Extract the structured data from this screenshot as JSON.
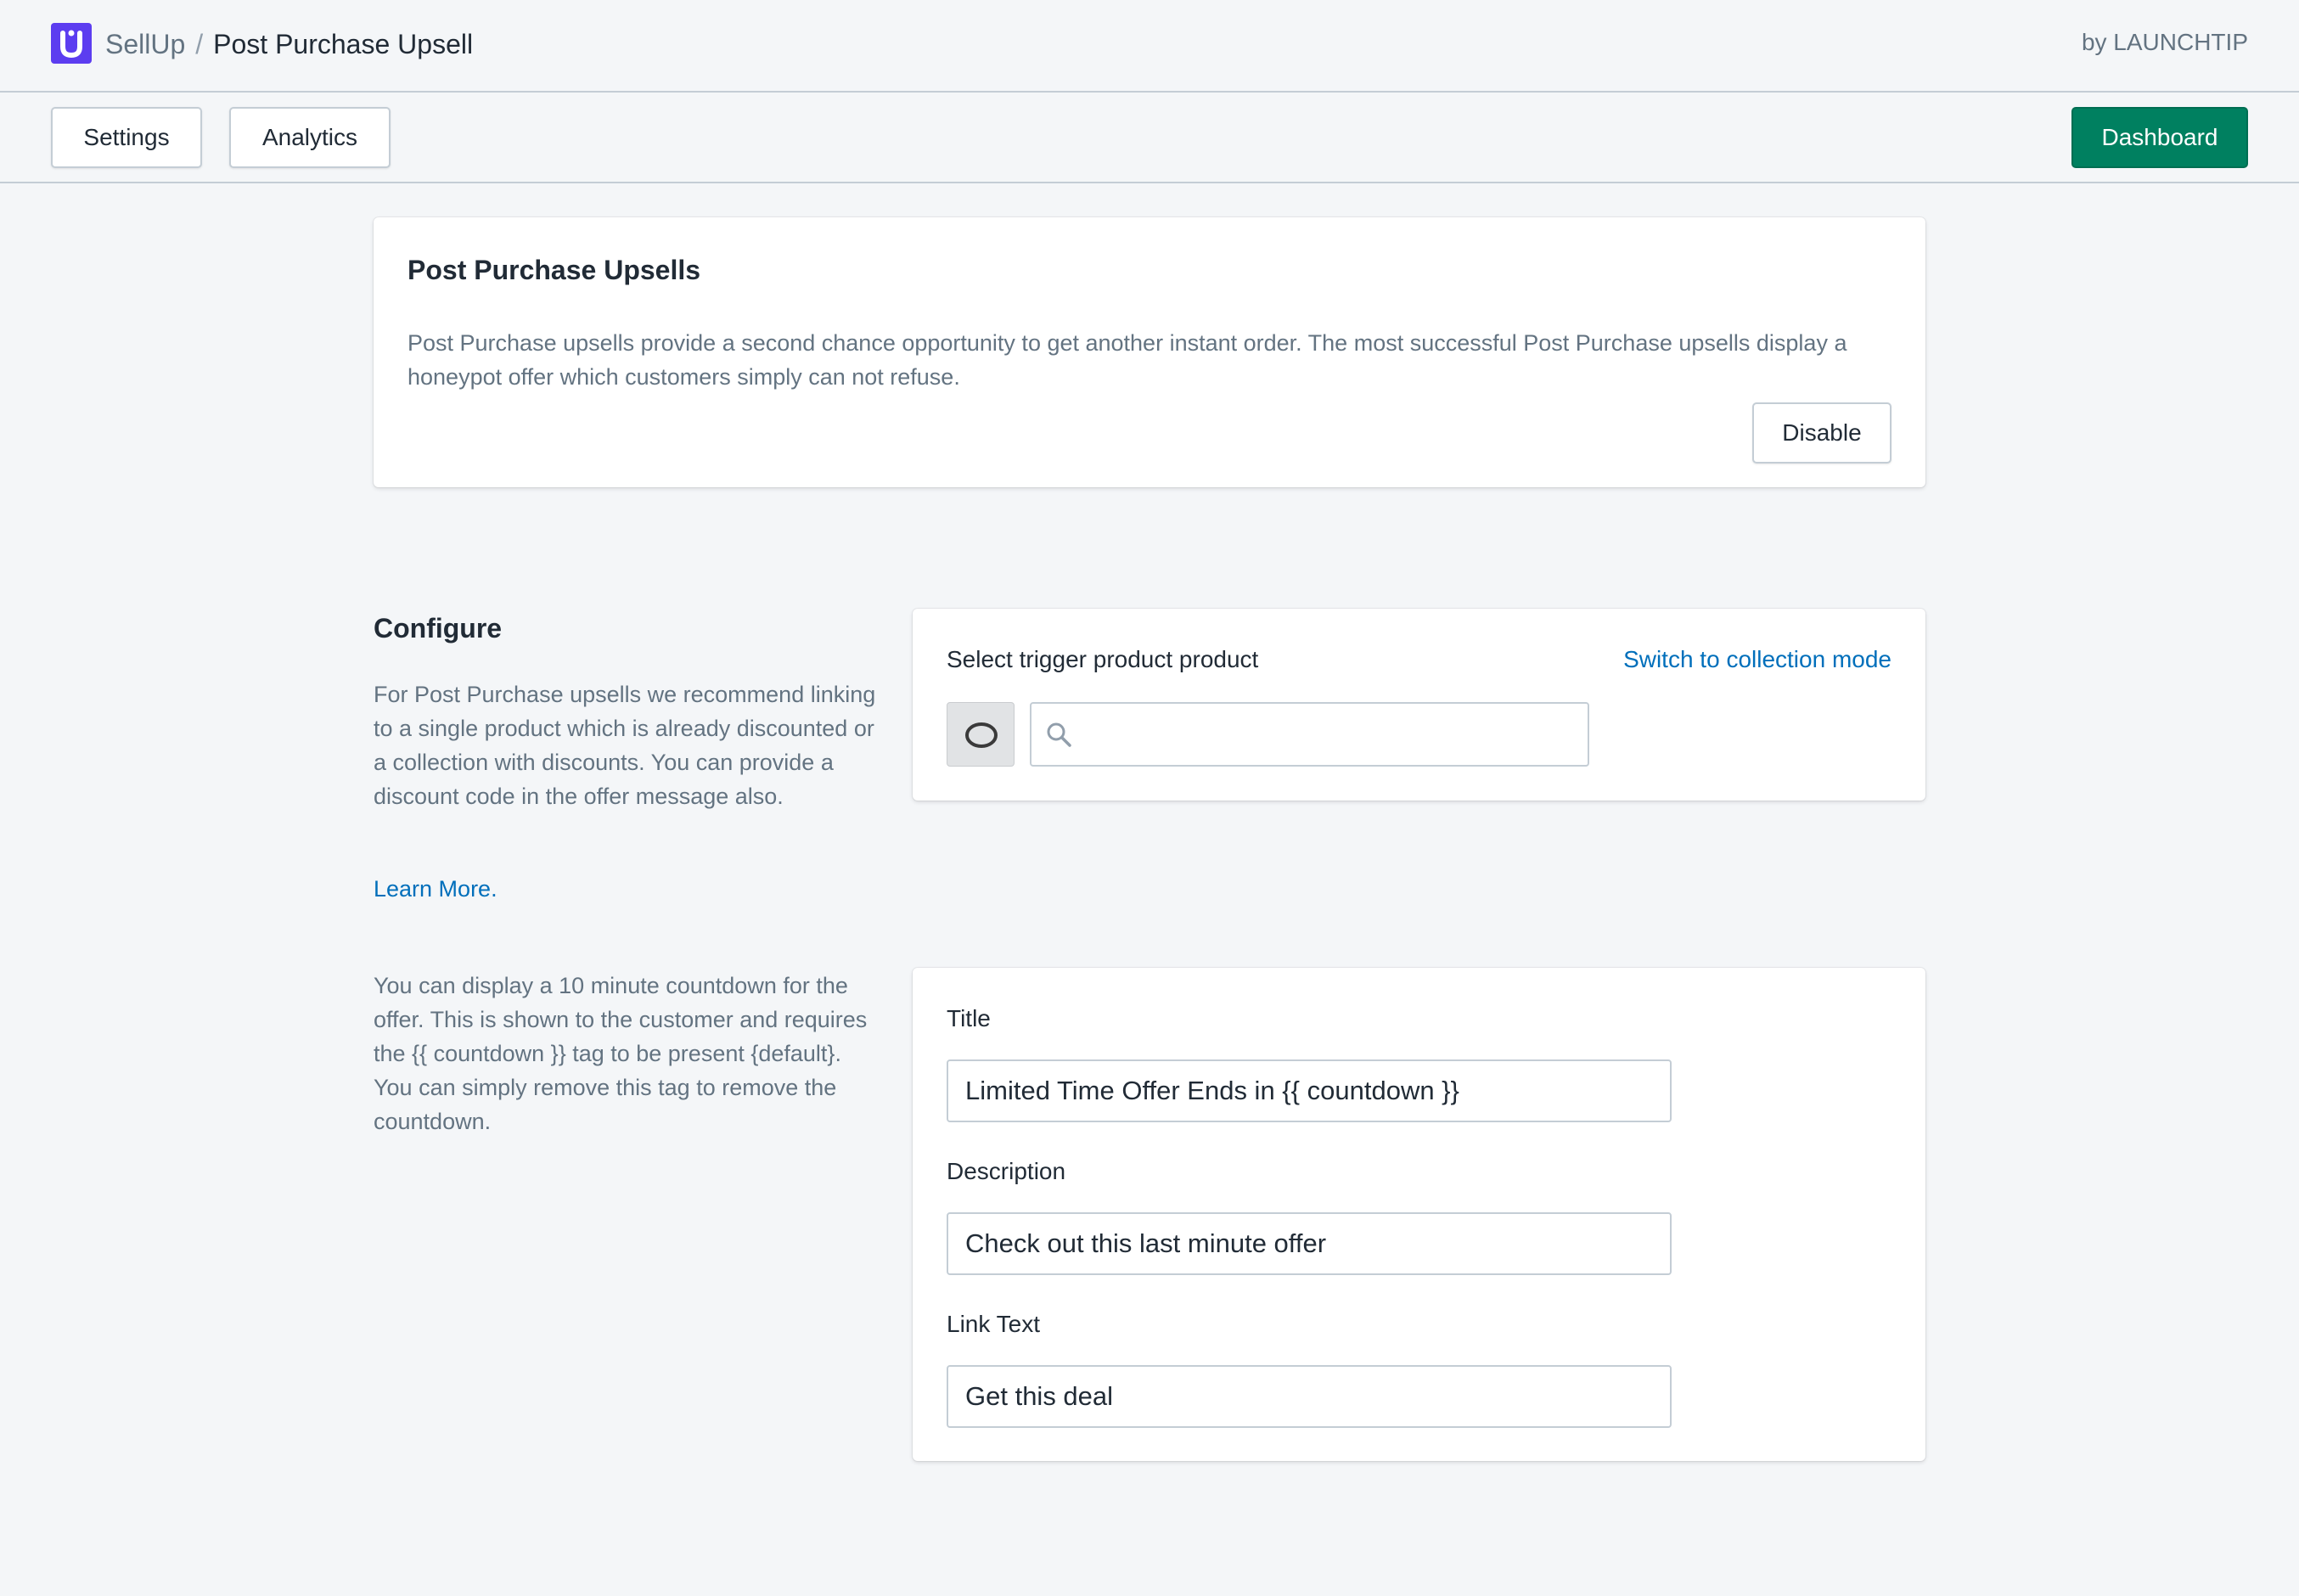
{
  "header": {
    "app_name": "SellUp",
    "separator": "/",
    "page_name": "Post Purchase Upsell",
    "byline": "by LAUNCHTIP"
  },
  "toolbar": {
    "settings_label": "Settings",
    "analytics_label": "Analytics",
    "dashboard_label": "Dashboard"
  },
  "intro_card": {
    "title": "Post Purchase Upsells",
    "description": "Post Purchase upsells provide a second chance opportunity to get another instant order. The most successful Post Purchase upsells display a honeypot offer which customers simply can not refuse.",
    "disable_label": "Disable"
  },
  "configure": {
    "heading": "Configure",
    "description": "For Post Purchase upsells we recommend linking to a single product which is already discounted or a collection with discounts. You can provide a discount code in the offer message also.",
    "learn_more": "Learn More.",
    "countdown_description": "You can display a 10 minute countdown for the offer. This is shown to the customer and requires the {{ countdown }} tag to be present {default}. You can simply remove this tag to remove the countdown."
  },
  "trigger_card": {
    "label": "Select trigger product product",
    "switch_link": "Switch to collection mode",
    "search_value": "",
    "search_placeholder": ""
  },
  "form_card": {
    "title_label": "Title",
    "title_value": "Limited Time Offer Ends in {{ countdown }}",
    "description_label": "Description",
    "description_value": "Check out this last minute offer",
    "link_text_label": "Link Text",
    "link_text_value": "Get this deal"
  },
  "colors": {
    "brand": "#5c3df0",
    "primary": "#008060",
    "link": "#006fbb",
    "background": "#f4f6f8"
  },
  "icons": {
    "logo": "sellup-logo-icon",
    "search": "search-icon",
    "product": "product-thumbnail-icon"
  }
}
